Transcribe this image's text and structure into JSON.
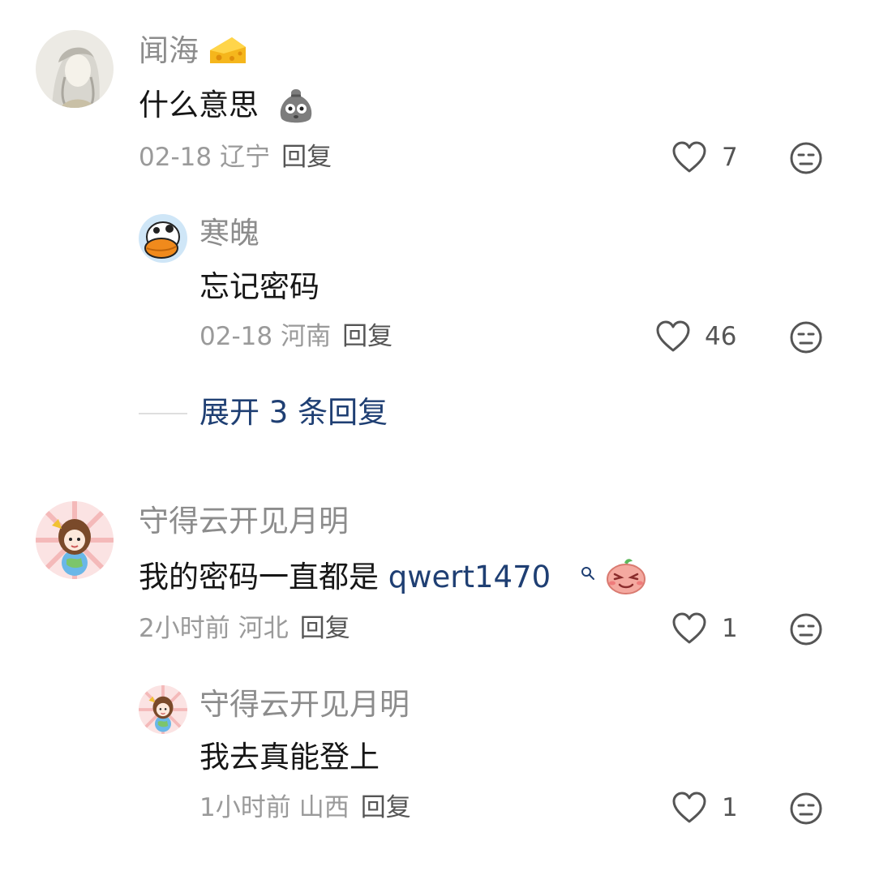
{
  "comments": [
    {
      "username": "闻海",
      "content": "什么意思",
      "time": "02-18",
      "location": "辽宁",
      "reply": "回复",
      "likes": "7",
      "badge_icon": "cheese-icon",
      "emoji": "sack-emoji"
    },
    {
      "username": "寒魄",
      "content": "忘记密码",
      "time": "02-18",
      "location": "河南",
      "reply": "回复",
      "likes": "46"
    },
    {
      "username": "守得云开见月明",
      "content_prefix": "我的密码一直都是 ",
      "content_link": "qwert1470",
      "time": "2小时前",
      "location": "河北",
      "reply": "回复",
      "likes": "1",
      "emoji": "pink-blob-emoji",
      "link_icon": "search-icon"
    },
    {
      "username": "守得云开见月明",
      "content": "我去真能登上",
      "time": "1小时前",
      "location": "山西",
      "reply": "回复",
      "likes": "1"
    }
  ],
  "expand_replies": "展开 3 条回复",
  "colors": {
    "link": "#1f3f73",
    "username": "#8c8c8c",
    "text": "#161616"
  }
}
